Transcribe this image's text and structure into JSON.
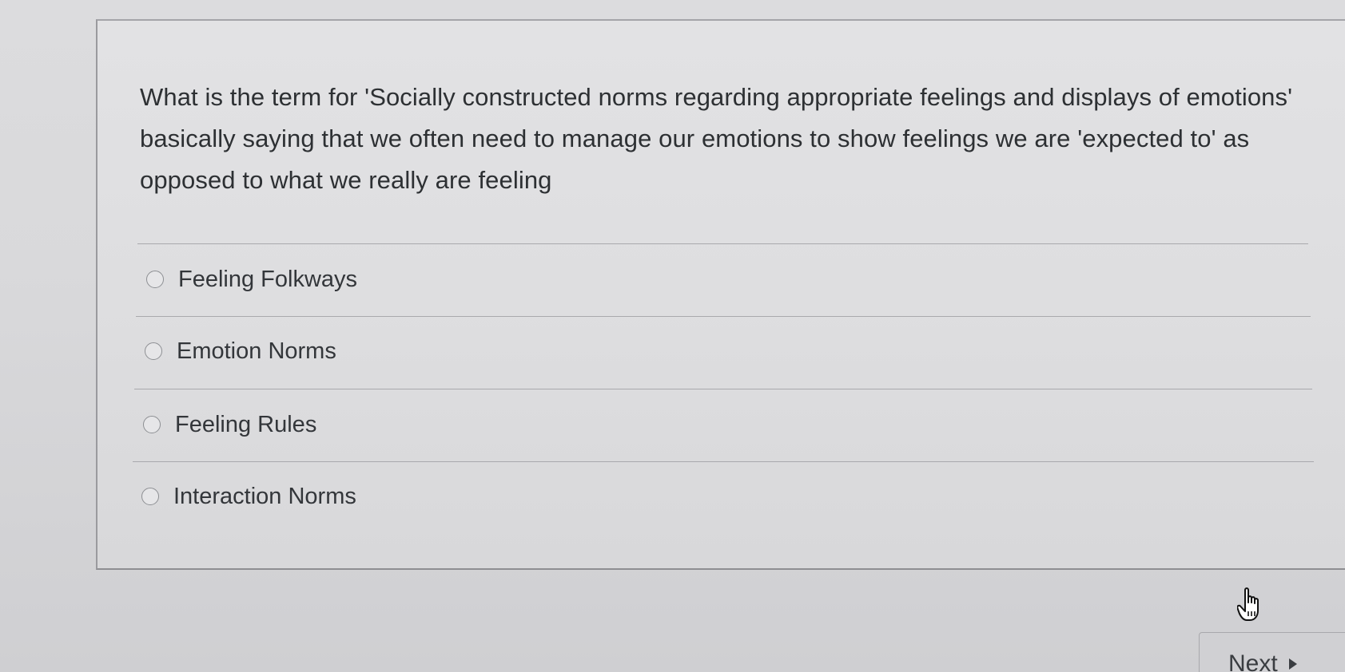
{
  "question": {
    "text": "What is the term for 'Socially constructed norms regarding appropriate feelings and displays of emotions' basically saying that we often need to manage our emotions to show feelings we are 'expected to' as opposed to what we really are feeling"
  },
  "answers": [
    {
      "label": "Feeling Folkways",
      "selected": false
    },
    {
      "label": "Emotion Norms",
      "selected": false
    },
    {
      "label": "Feeling Rules",
      "selected": false
    },
    {
      "label": "Interaction Norms",
      "selected": false
    }
  ],
  "navigation": {
    "next_label": "Next",
    "next_icon": "triangle-right-icon"
  },
  "cursor": {
    "icon": "hand-pointer-icon"
  }
}
